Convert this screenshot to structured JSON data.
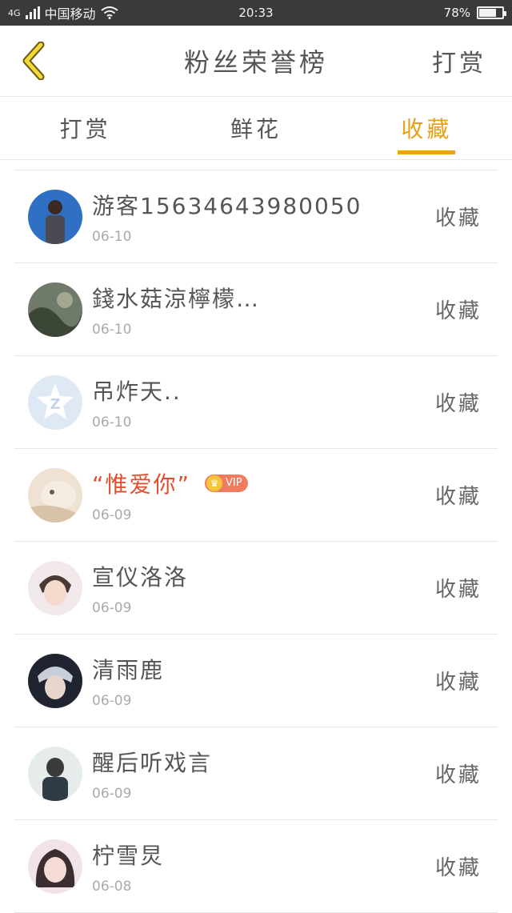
{
  "status_bar": {
    "network": "4G",
    "carrier": "中国移动",
    "time": "20:33",
    "battery_percent": "78%",
    "battery_level": 0.78
  },
  "header": {
    "back_icon": "chevron-left-icon",
    "title": "粉丝荣誉榜",
    "right_action": "打赏"
  },
  "tabs": [
    {
      "label": "打赏",
      "active": false
    },
    {
      "label": "鲜花",
      "active": false
    },
    {
      "label": "收藏",
      "active": true
    }
  ],
  "colors": {
    "accent": "#f0a11a",
    "vip_name": "#e0502f",
    "status_bar": "#3a3a3a"
  },
  "list": [
    {
      "name": "游客15634643980050",
      "date": "06-10",
      "action": "收藏"
    },
    {
      "name": "錢水菇涼檸檬…",
      "date": "06-10",
      "action": "收藏"
    },
    {
      "name": "吊炸天..",
      "date": "06-10",
      "action": "收藏"
    },
    {
      "name": "“惟爱你”",
      "date": "06-09",
      "action": "收藏",
      "vip_badge": "VIP"
    },
    {
      "name": "宣仪洛洛",
      "date": "06-09",
      "action": "收藏"
    },
    {
      "name": "清雨鹿",
      "date": "06-09",
      "action": "收藏"
    },
    {
      "name": "醒后听戏言",
      "date": "06-09",
      "action": "收藏"
    },
    {
      "name": "柠雪炅",
      "date": "06-08",
      "action": "收藏"
    }
  ]
}
